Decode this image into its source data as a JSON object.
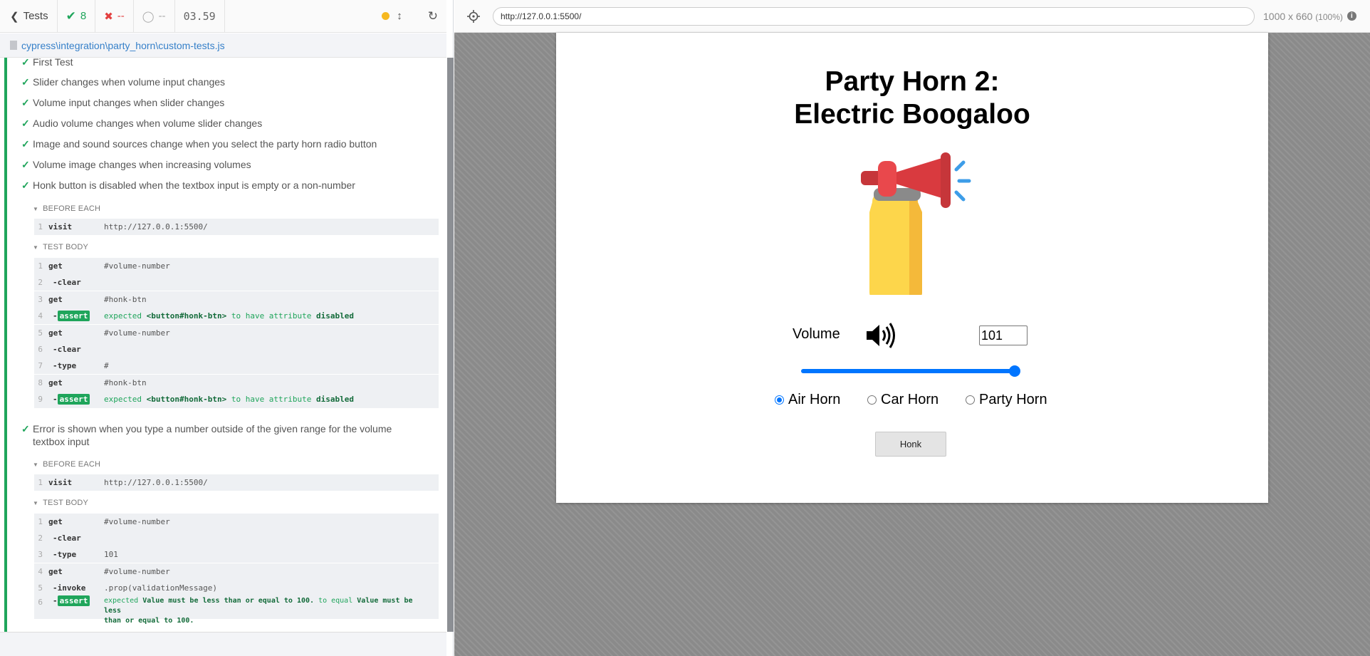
{
  "reporter": {
    "header": {
      "tests_label": "Tests",
      "passed": "8",
      "failed": "--",
      "pending": "--",
      "duration": "03.59"
    },
    "spec_path": "cypress\\integration\\party_horn\\custom-tests.js",
    "tests": [
      "First Test",
      "Slider changes when volume input changes",
      "Volume input changes when slider changes",
      "Audio volume changes when volume slider changes",
      "Image and sound sources change when you select the party horn radio button",
      "Volume image changes when increasing volumes",
      "Honk button is disabled when the textbox input is empty or a non-number",
      "Error is shown when you type a number outside of the given range for the volume textbox input"
    ],
    "before_each_label": "BEFORE EACH",
    "test_body_label": "TEST BODY",
    "test7": {
      "before_each": [
        {
          "n": "1",
          "cmd": "visit",
          "msg": "http://127.0.0.1:5500/"
        }
      ],
      "body": [
        {
          "n": "1",
          "cmd": "get",
          "msg": "#volume-number"
        },
        {
          "n": "2",
          "cmd": "-clear",
          "msg": ""
        },
        {
          "n": "3",
          "cmd": "get",
          "msg": "#honk-btn"
        },
        {
          "n": "4",
          "cmd": "-assert",
          "msg": "expected <button#honk-btn> to have attribute disabled"
        },
        {
          "n": "5",
          "cmd": "get",
          "msg": "#volume-number"
        },
        {
          "n": "6",
          "cmd": "-clear",
          "msg": ""
        },
        {
          "n": "7",
          "cmd": "-type",
          "msg": "#"
        },
        {
          "n": "8",
          "cmd": "get",
          "msg": "#honk-btn"
        },
        {
          "n": "9",
          "cmd": "-assert",
          "msg": "expected <button#honk-btn> to have attribute disabled"
        }
      ]
    },
    "test8": {
      "before_each": [
        {
          "n": "1",
          "cmd": "visit",
          "msg": "http://127.0.0.1:5500/"
        }
      ],
      "body": [
        {
          "n": "1",
          "cmd": "get",
          "msg": "#volume-number"
        },
        {
          "n": "2",
          "cmd": "-clear",
          "msg": ""
        },
        {
          "n": "3",
          "cmd": "-type",
          "msg": "101"
        },
        {
          "n": "4",
          "cmd": "get",
          "msg": "#volume-number"
        },
        {
          "n": "5",
          "cmd": "-invoke",
          "msg": ".prop(validationMessage)"
        },
        {
          "n": "6",
          "cmd": "-assert",
          "msg": "expected Value must be less than or equal to 100. to equal Value must be less than or equal to 100."
        }
      ]
    },
    "assert_parts": {
      "expected": "expected",
      "honk_el": "<button#honk-btn>",
      "to_have_attr": "to have attribute",
      "disabled": "disabled",
      "validation_value": "Value must be less than or equal to 100.",
      "to_equal": "to equal",
      "validation_line1": "Value must be less",
      "validation_line2": "than or equal to 100."
    }
  },
  "browser": {
    "url": "http://127.0.0.1:5500/",
    "viewport": "1000 x 660",
    "zoom": "(100%)"
  },
  "app": {
    "title_line1": "Party Horn 2:",
    "title_line2": "Electric Boogaloo",
    "volume_label": "Volume",
    "volume_value": "101",
    "slider_level": 1.0,
    "radios": [
      {
        "label": "Air Horn",
        "checked": true
      },
      {
        "label": "Car Horn",
        "checked": false
      },
      {
        "label": "Party Horn",
        "checked": false
      }
    ],
    "honk_label": "Honk"
  },
  "colors": {
    "pass": "#1fa55b",
    "fail": "#e34040",
    "accent": "#0075ff",
    "link": "#3680c9"
  }
}
